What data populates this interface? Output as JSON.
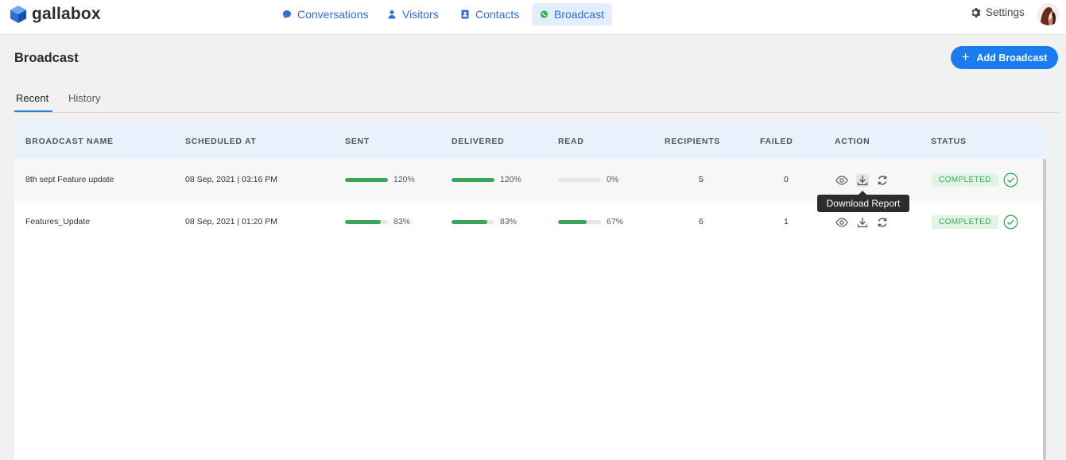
{
  "brand": {
    "name": "gallabox",
    "logo_icon": "cube-logo-icon",
    "color": "#2f6fd6"
  },
  "nav": {
    "items": [
      {
        "label": "Conversations",
        "icon": "chat-bubble-icon"
      },
      {
        "label": "Visitors",
        "icon": "user-icon"
      },
      {
        "label": "Contacts",
        "icon": "contact-book-icon"
      },
      {
        "label": "Broadcast",
        "icon": "whatsapp-icon",
        "active": true
      }
    ],
    "settings_label": "Settings",
    "settings_icon": "gear-icon"
  },
  "page": {
    "title": "Broadcast",
    "add_button_label": "Add Broadcast",
    "add_button_icon": "plus-icon",
    "accent_color": "#1a7cf0"
  },
  "tabs": [
    {
      "label": "Recent",
      "active": true
    },
    {
      "label": "History",
      "active": false
    }
  ],
  "table": {
    "columns": [
      "BROADCAST NAME",
      "SCHEDULED AT",
      "SENT",
      "DELIVERED",
      "READ",
      "RECIPIENTS",
      "FAILED",
      "ACTION",
      "STATUS"
    ],
    "rows": [
      {
        "name": "8th sept Feature update",
        "scheduled_at": "08 Sep, 2021 | 03:16 PM",
        "sent": {
          "label": "120%",
          "fraction": 1.0
        },
        "delivered": {
          "label": "120%",
          "fraction": 1.0
        },
        "read": {
          "label": "0%",
          "fraction": 0.0
        },
        "recipients": "5",
        "failed": "0",
        "actions": [
          "eye-icon",
          "download-icon",
          "refresh-icon"
        ],
        "status": "COMPLETED"
      },
      {
        "name": "Features_Update",
        "scheduled_at": "08 Sep, 2021 | 01:20 PM",
        "sent": {
          "label": "83%",
          "fraction": 0.83
        },
        "delivered": {
          "label": "83%",
          "fraction": 0.83
        },
        "read": {
          "label": "67%",
          "fraction": 0.67
        },
        "recipients": "6",
        "failed": "1",
        "actions": [
          "eye-icon",
          "download-icon",
          "refresh-icon"
        ],
        "status": "COMPLETED"
      }
    ],
    "progress_color": "#3ba55c",
    "status_color": "#3aa857"
  },
  "tooltip": {
    "text": "Download Report"
  }
}
